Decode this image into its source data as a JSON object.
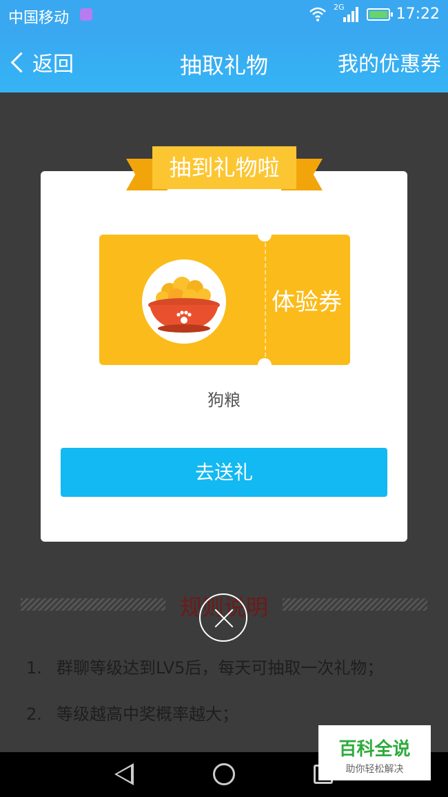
{
  "status_bar": {
    "carrier": "中国移动",
    "network": "2G",
    "time": "17:22"
  },
  "header": {
    "back_label": "返回",
    "title": "抽取礼物",
    "coupons_link": "我的优惠券"
  },
  "dialog": {
    "banner": "抽到礼物啦",
    "ticket_label": "体验券",
    "gift_name": "狗粮",
    "action_button": "去送礼"
  },
  "rules": {
    "title": "规则说明",
    "items": [
      {
        "num": "1.",
        "text": "群聊等级达到LV5后，每天可抽取一次礼物；"
      },
      {
        "num": "2.",
        "text": "等级越高中奖概率越大；"
      }
    ]
  },
  "watermark": {
    "title": "百科全说",
    "subtitle": "助你轻松解决"
  },
  "colors": {
    "accent": "#12b9f2",
    "header": "#3aa8f0",
    "ticket": "#fbbb1a",
    "banner": "#fcc632"
  }
}
